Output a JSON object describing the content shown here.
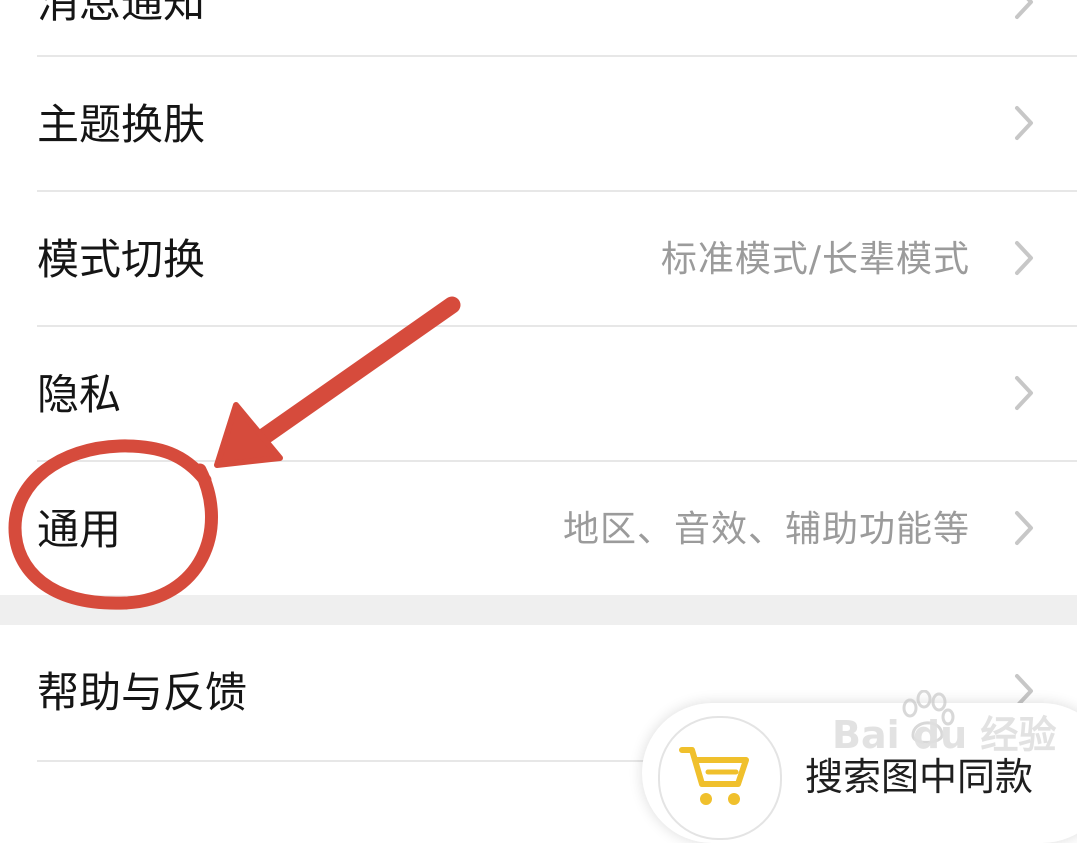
{
  "settings": {
    "items": [
      {
        "label": "消息通知",
        "value": ""
      },
      {
        "label": "主题换肤",
        "value": ""
      },
      {
        "label": "模式切换",
        "value": "标准模式/长辈模式"
      },
      {
        "label": "隐私",
        "value": ""
      },
      {
        "label": "通用",
        "value": "地区、音效、辅助功能等"
      },
      {
        "label": "帮助与反馈",
        "value": ""
      }
    ]
  },
  "floating_action": {
    "label": "搜索图中同款",
    "icon": "shopping-cart-icon"
  },
  "watermark": {
    "text": "Bai du 经验"
  },
  "annotation": {
    "color": "#d64b3c"
  },
  "icons": {
    "chevron": "chevron-right-icon",
    "cart": "shopping-cart-icon",
    "paw": "baidu-paw-icon"
  }
}
